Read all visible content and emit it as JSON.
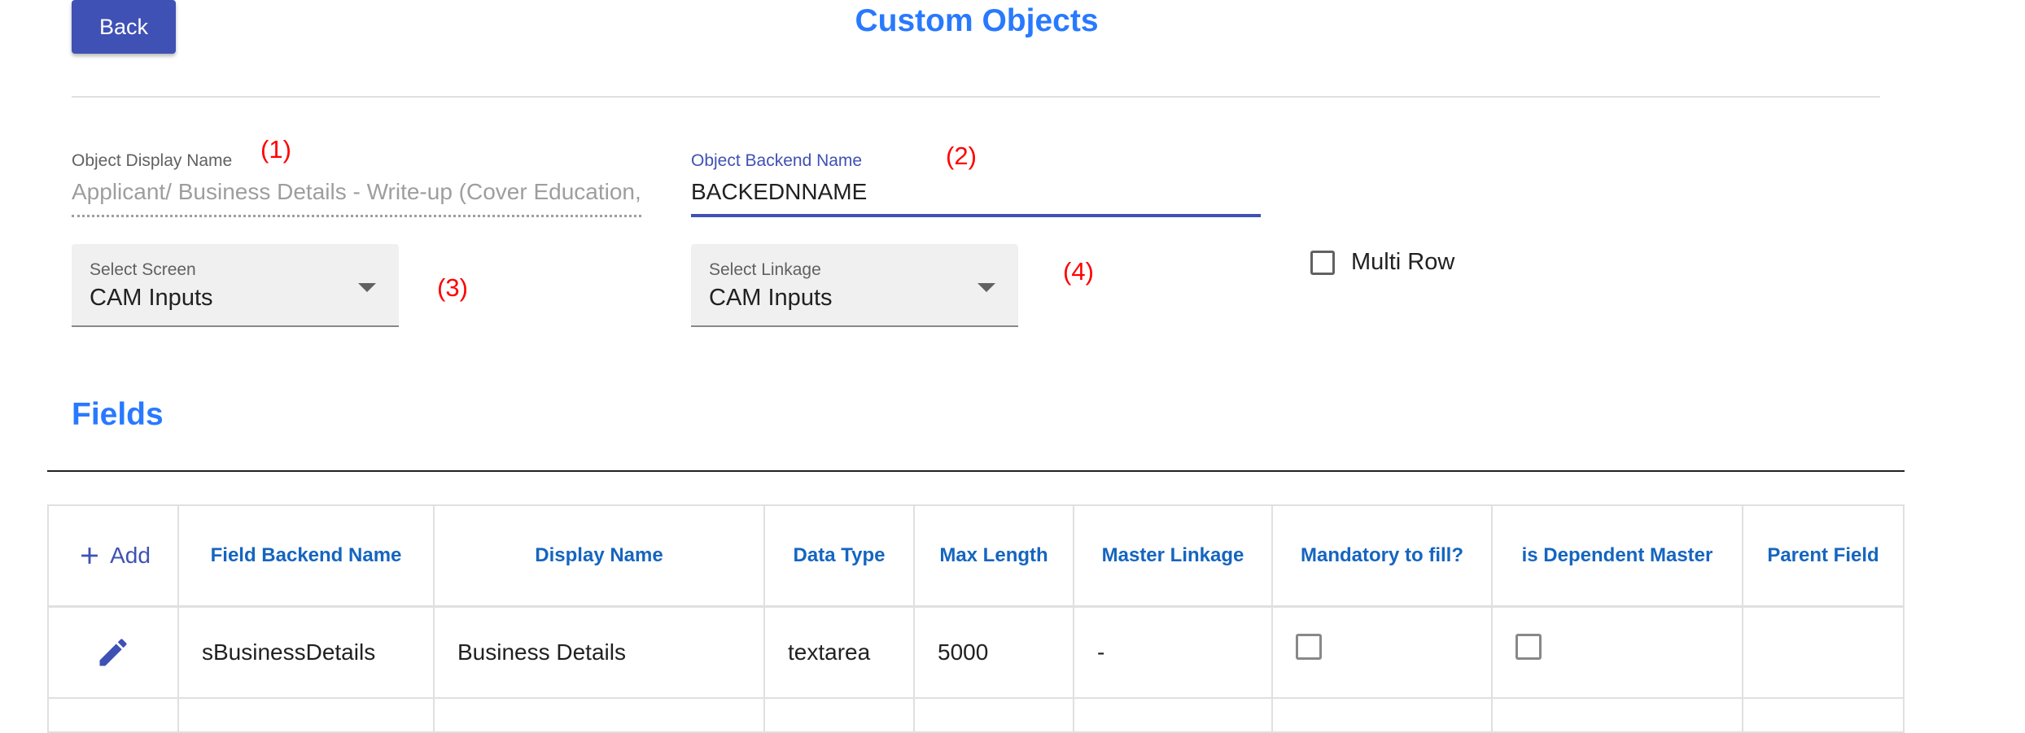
{
  "header": {
    "back_label": "Back",
    "title": "Custom Objects"
  },
  "form": {
    "display_name": {
      "label": "Object Display Name",
      "value": "Applicant/ Business Details - Write-up (Cover Education,",
      "annotation": "(1)"
    },
    "backend_name": {
      "label": "Object Backend Name",
      "value": "BACKEDNNAME",
      "annotation": "(2)"
    },
    "select_screen": {
      "label": "Select Screen",
      "value": "CAM Inputs",
      "annotation": "(3)"
    },
    "select_linkage": {
      "label": "Select Linkage",
      "value": "CAM Inputs",
      "annotation": "(4)"
    },
    "multi_row": {
      "label": "Multi Row",
      "checked": false
    }
  },
  "fields_section": {
    "title": "Fields",
    "add_label": "Add",
    "columns": [
      "Field Backend Name",
      "Display Name",
      "Data Type",
      "Max Length",
      "Master Linkage",
      "Mandatory to fill?",
      "is Dependent Master",
      "Parent Field"
    ],
    "rows": [
      {
        "field_backend_name": "sBusinessDetails",
        "display_name": "Business Details",
        "data_type": "textarea",
        "max_length": "5000",
        "master_linkage": "-",
        "mandatory": false,
        "is_dependent_master": false,
        "parent_field": ""
      }
    ]
  },
  "colors": {
    "primary": "#3f51b5",
    "title_blue": "#2979ff",
    "header_blue": "#1565c0",
    "annotation_red": "#ff0000"
  },
  "icons": {
    "add": "plus-icon",
    "edit": "pencil-icon",
    "dropdown": "chevron-down-icon"
  }
}
